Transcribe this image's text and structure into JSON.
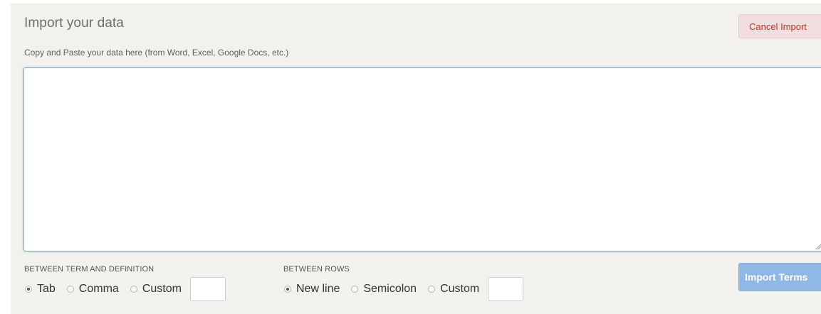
{
  "header": {
    "title": "Import your data",
    "subtitle": "Copy and Paste your data here (from Word, Excel, Google Docs, etc.)",
    "cancel_label": "Cancel Import"
  },
  "data_area": {
    "value": "",
    "placeholder": ""
  },
  "term_definition": {
    "label": "BETWEEN TERM AND DEFINITION",
    "options": [
      {
        "label": "Tab",
        "checked": true
      },
      {
        "label": "Comma",
        "checked": false
      },
      {
        "label": "Custom",
        "checked": false
      }
    ],
    "custom_value": ""
  },
  "rows": {
    "label": "BETWEEN ROWS",
    "options": [
      {
        "label": "New line",
        "checked": true
      },
      {
        "label": "Semicolon",
        "checked": false
      },
      {
        "label": "Custom",
        "checked": false
      }
    ],
    "custom_value": ""
  },
  "footer": {
    "import_label": "Import Terms"
  },
  "colors": {
    "panel_bg": "#f3f1ee",
    "cancel_text": "#c9302c",
    "cancel_bg": "#f2dede",
    "import_bg": "#8fb8e6",
    "focus_border": "#66afe9"
  }
}
